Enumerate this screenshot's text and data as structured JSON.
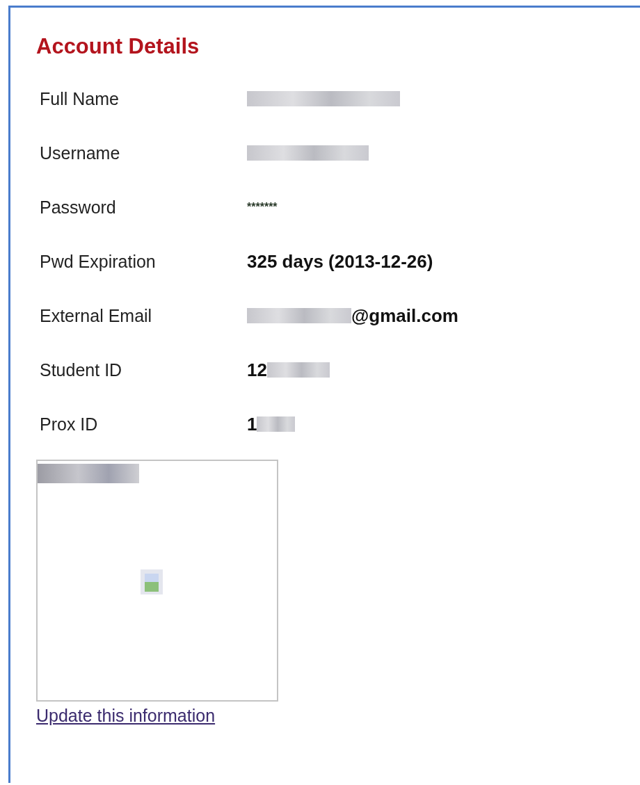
{
  "title": "Account Details",
  "rows": [
    {
      "label": "Full Name",
      "kind": "plain",
      "parts": [
        {
          "kind": "blur"
        }
      ]
    },
    {
      "label": "Username",
      "kind": "plain",
      "parts": [
        {
          "kind": "blur"
        }
      ]
    },
    {
      "label": "Password",
      "kind": "masked",
      "parts": [
        {
          "kind": "text",
          "text": "*******"
        }
      ]
    },
    {
      "label": "Pwd Expiration",
      "kind": "bold",
      "parts": [
        {
          "kind": "text",
          "text": "325 days (2013-12-26)"
        }
      ]
    },
    {
      "label": "External Email",
      "kind": "bold",
      "parts": [
        {
          "kind": "blur"
        },
        {
          "kind": "text",
          "text": "@gmail.com"
        }
      ]
    },
    {
      "label": "Student ID",
      "kind": "bold",
      "parts": [
        {
          "kind": "text",
          "text": "12"
        },
        {
          "kind": "blur"
        }
      ]
    },
    {
      "label": "Prox ID",
      "kind": "bold",
      "parts": [
        {
          "kind": "text",
          "text": "1"
        },
        {
          "kind": "blur"
        }
      ]
    }
  ],
  "photo": {
    "kind": "broken-image"
  },
  "link": "Update this information"
}
